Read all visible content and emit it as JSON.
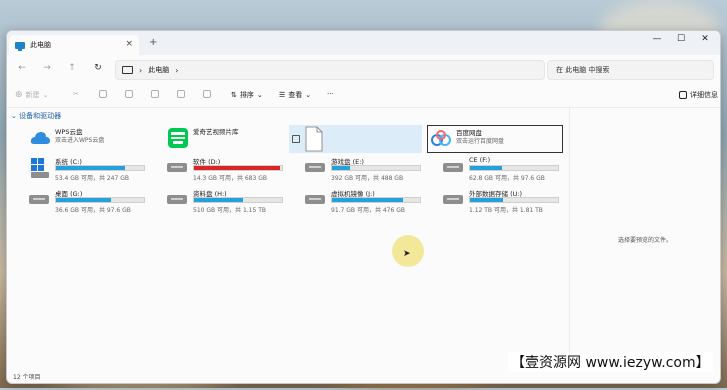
{
  "window": {
    "tab_title": "此电脑",
    "new_tab": "+",
    "controls": {
      "minimize": "—",
      "maximize": "☐",
      "close": "✕"
    }
  },
  "address": {
    "crumb": "此电脑",
    "search_placeholder": "在 此电脑 中搜索"
  },
  "toolbar": {
    "new": "新建",
    "sort": "排序",
    "view": "查看",
    "more": "···",
    "details": "详细信息"
  },
  "sections": {
    "devices": "设备和驱动器"
  },
  "items": {
    "wps": {
      "name": "WPS云盘",
      "sub": "双击进入WPS云盘"
    },
    "iqiyi": {
      "name": "爱奇艺视频片库"
    },
    "blank": {
      "name": ""
    },
    "baidu": {
      "name": "百度网盘",
      "sub": "双击运行百度网盘"
    },
    "drives": [
      {
        "name": "系统 (C:)",
        "free": "53.4 GB 可用，共 247 GB",
        "used_pct": 78
      },
      {
        "name": "软件 (D:)",
        "free": "14.3 GB 可用，共 683 GB",
        "used_pct": 98
      },
      {
        "name": "游戏盘 (E:)",
        "free": "392 GB 可用，共 488 GB",
        "used_pct": 20
      },
      {
        "name": "CE (F:)",
        "free": "62.8 GB 可用，共 97.6 GB",
        "used_pct": 36
      },
      {
        "name": "桌面 (G:)",
        "free": "36.6 GB 可用，共 97.6 GB",
        "used_pct": 62
      },
      {
        "name": "资料盘 (H:)",
        "free": "510 GB 可用，共 1.15 TB",
        "used_pct": 56
      },
      {
        "name": "虚拟机镜像 (J:)",
        "free": "91.7 GB 可用，共 476 GB",
        "used_pct": 81
      },
      {
        "name": "外部数据存储 (U:)",
        "free": "1.12 TB 可用，共 1.81 TB",
        "used_pct": 38
      }
    ]
  },
  "details_pane": {
    "message": "选择要预览的文件。"
  },
  "status": {
    "count": "12 个项目"
  },
  "watermark": "【壹资源网 www.iezyw.com】",
  "colors": {
    "bar_normal": "#26a0da",
    "bar_full": "#da2626"
  }
}
